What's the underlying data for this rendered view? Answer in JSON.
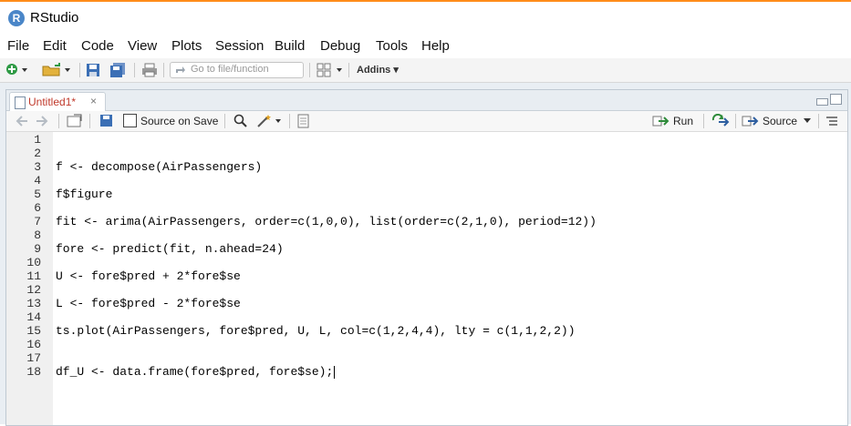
{
  "window": {
    "title": "RStudio",
    "logo_letter": "R"
  },
  "menu": [
    "File",
    "Edit",
    "Code",
    "View",
    "Plots",
    "Session",
    "Build",
    "Debug",
    "Tools",
    "Help"
  ],
  "toolbar": {
    "goto_placeholder": "Go to file/function",
    "addins_label": "Addins ▾"
  },
  "editor": {
    "tab_label": "Untitled1*",
    "tab_close": "×",
    "source_on_save_label": "Source on Save",
    "run_label": "Run",
    "source_label": "Source",
    "lines": [
      {
        "n": "1",
        "text": ""
      },
      {
        "n": "2",
        "text": ""
      },
      {
        "n": "3",
        "text": "f <- decompose(AirPassengers)"
      },
      {
        "n": "4",
        "text": ""
      },
      {
        "n": "5",
        "text": "f$figure"
      },
      {
        "n": "6",
        "text": ""
      },
      {
        "n": "7",
        "text": "fit <- arima(AirPassengers, order=c(1,0,0), list(order=c(2,1,0), period=12))"
      },
      {
        "n": "8",
        "text": ""
      },
      {
        "n": "9",
        "text": "fore <- predict(fit, n.ahead=24)"
      },
      {
        "n": "10",
        "text": ""
      },
      {
        "n": "11",
        "text": "U <- fore$pred + 2*fore$se"
      },
      {
        "n": "12",
        "text": ""
      },
      {
        "n": "13",
        "text": "L <- fore$pred - 2*fore$se"
      },
      {
        "n": "14",
        "text": ""
      },
      {
        "n": "15",
        "text": "ts.plot(AirPassengers, fore$pred, U, L, col=c(1,2,4,4), lty = c(1,1,2,2))"
      },
      {
        "n": "16",
        "text": ""
      },
      {
        "n": "17",
        "text": ""
      },
      {
        "n": "18",
        "text": "df_U <- data.frame(fore$pred, fore$se);"
      }
    ]
  },
  "colors": {
    "accent_top": "#ff8c1a",
    "tab_dirty": "#c0392b",
    "run_green": "#2e8b3a"
  }
}
